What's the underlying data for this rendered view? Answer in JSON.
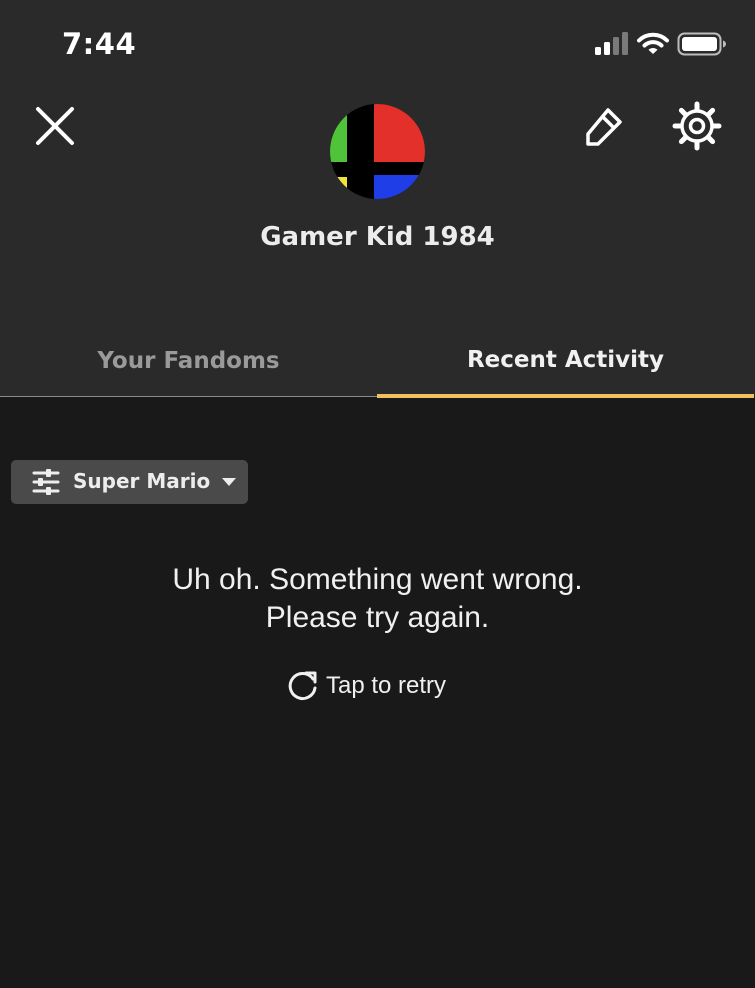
{
  "status_bar": {
    "time": "7:44",
    "icons": [
      "cellular-signal-icon",
      "wifi-icon",
      "battery-icon"
    ]
  },
  "header": {
    "close_icon": "close-icon",
    "edit_icon": "pencil-icon",
    "settings_icon": "gear-icon",
    "username": "Gamer Kid 1984"
  },
  "tabs": [
    {
      "label": "Your Fandoms",
      "selected": false
    },
    {
      "label": "Recent Activity",
      "selected": true
    }
  ],
  "filter": {
    "icon": "sliders-icon",
    "label": "Super Mario",
    "caret_icon": "caret-down-icon"
  },
  "error": {
    "message": "Uh oh. Something went wrong. Please try again.",
    "retry_icon": "refresh-icon",
    "retry_label": "Tap to retry"
  },
  "colors": {
    "header_bg": "#2a2a2a",
    "content_bg": "#191919",
    "tab_indicator": "#f2bf5f",
    "chip_bg": "#4a4a4a"
  }
}
